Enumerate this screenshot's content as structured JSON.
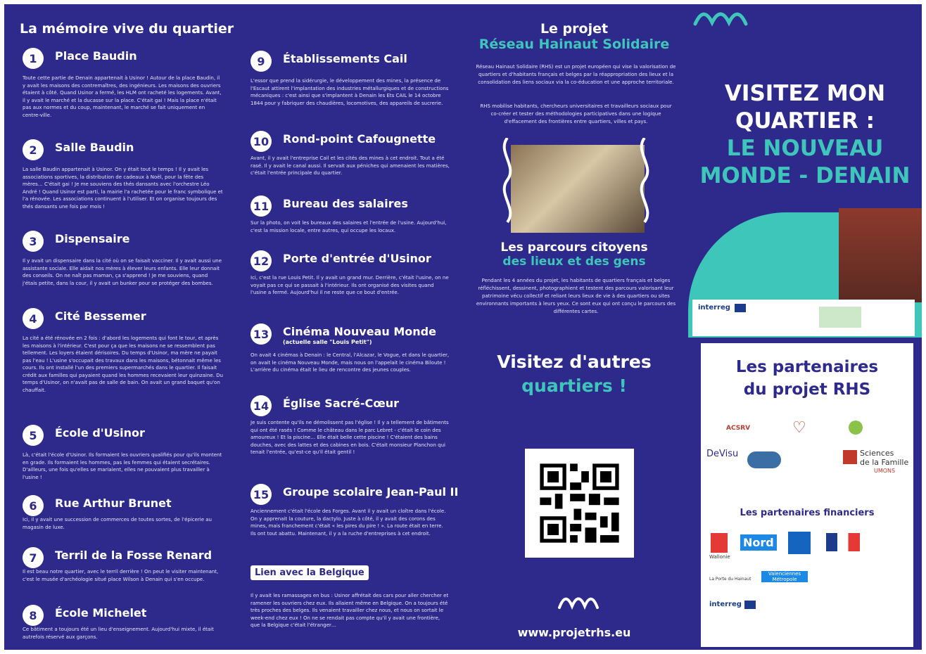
{
  "col1": {
    "heading": "La mémoire vive du quartier",
    "items": [
      {
        "num": "1",
        "name": "Place Baudin",
        "desc": "Toute cette partie de Denain appartenait à Usinor ! Autour de la place Baudin, il y avait les maisons des contremaîtres, des ingénieurs. Les maisons des ouvriers étaient à côté. Quand Usinor a fermé, les HLM ont racheté les logements. Avant, il y avait le marché et la ducasse sur la place. C'était gai ! Mais la place n'était pas aux normes et du coup, maintenant, le marché se fait uniquement en centre-ville."
      },
      {
        "num": "2",
        "name": "Salle Baudin",
        "desc": "La salle Baudin appartenait à Usinor. On y était tout le temps ! Il y avait les associations sportives, la distribution de cadeaux à Noël, pour la fête des mères… C'était gai ! Je me souviens des thés dansants avec l'orchestre Léo André ! Quand Usinor est parti, la mairie l'a rachetée pour le franc symbolique et l'a rénovée. Les associations continuent à l'utiliser. Et on organise toujours des thés dansants une fois par mois !"
      },
      {
        "num": "3",
        "name": "Dispensaire",
        "desc": "Il y avait un dispensaire dans la cité où on se faisait vacciner. Il y avait aussi une assistante sociale. Elle aidait nos mères à élever leurs enfants. Elle leur donnait des conseils. On ne naît pas maman, ça s'apprend ! Je me souviens, quand j'étais petite, dans la cour, il y avait un bunker pour se protéger des bombes."
      },
      {
        "num": "4",
        "name": "Cité Bessemer",
        "desc": "La cité a été rénovée en 2 fois : d'abord les logements qui font le tour, et après les maisons à l'intérieur. C'est pour ça que les maisons ne se ressemblent pas tellement. Les loyers étaient dérisoires. Du temps d'Usinor, ma mère ne payait pas l'eau ! L'usine s'occupait des travaux dans les maisons, bétonnait même les cours. Ils ont installé l'un des premiers supermarchés dans le quartier. Il faisait crédit aux familles qui payaient quand les hommes recevaient leur quinzaine. Du temps d'Usinor, on n'avait pas de salle de bain. On avait un grand baquet qu'on chauffait."
      },
      {
        "num": "5",
        "name": "École d'Usinor",
        "desc": "Là, c'était l'école d'Usinor. Ils formaient les ouvriers qualifiés pour qu'ils montent en grade. Ils formaient les hommes, pas les femmes qui étaient secrétaires. D'ailleurs, une fois qu'elles se mariaient, elles ne pouvaient plus travailler à l'usine !"
      },
      {
        "num": "6",
        "name": "Rue Arthur Brunet",
        "desc": "Ici, il y avait une succession de commerces de toutes sortes, de l'épicerie au magasin de luxe."
      },
      {
        "num": "7",
        "name": "Terril de la Fosse Renard",
        "desc": "Il est beau notre quartier, avec le terril derrière ! On peut le visiter maintenant, c'est le musée d'archéologie situé place Wilson à Denain qui s'en occupe."
      },
      {
        "num": "8",
        "name": "École Michelet",
        "desc": "Ce bâtiment a toujours été un lieu d'enseignement. Aujourd'hui mixte, il était autrefois réservé aux garçons."
      }
    ]
  },
  "col2": {
    "items": [
      {
        "num": "9",
        "name": "Établissements Cail",
        "sub": "",
        "desc": "L'essor que prend la sidérurgie, le développement des mines, la présence de l'Escaut attirent l'implantation des industries métallurgiques et de constructions mécaniques : c'est ainsi que s'implantent à Denain les Ets CAIL le 14 octobre 1844 pour y fabriquer des chaudières, locomotives, des appareils de sucrerie."
      },
      {
        "num": "10",
        "name": "Rond-point Cafougnette",
        "sub": "",
        "desc": "Avant, il y avait l'entreprise Cail et les cités des mines à cet endroit. Tout a été rasé. Il y avait le canal aussi. Il servait aux péniches qui amenaient les matières, c'était l'entrée principale du quartier."
      },
      {
        "num": "11",
        "name": "Bureau des salaires",
        "sub": "",
        "desc": "Sur la photo, on voit les bureaux des salaires et l'entrée de l'usine. Aujourd'hui, c'est la mission locale, entre autres, qui occupe les locaux."
      },
      {
        "num": "12",
        "name": "Porte d'entrée d'Usinor",
        "sub": "",
        "desc": "Ici, c'est la rue Louis Petit. Il y avait un grand mur. Derrière, c'était l'usine, on ne voyait pas ce qui se passait à l'intérieur. Ils ont organisé des visites quand l'usine a fermé. Aujourd'hui il ne reste que ce bout d'entrée."
      },
      {
        "num": "13",
        "name": "Cinéma Nouveau Monde",
        "sub": "(actuelle salle \"Louis Petit\")",
        "desc": "On avait 4 cinémas à Denain : le Central, l'Alcazar, le Vogue, et dans le quartier, on avait le cinéma Nouveau Monde, mais nous on l'appelait le cinéma Biloute ! L'arrière du cinéma était le lieu de rencontre des jeunes couples."
      },
      {
        "num": "14",
        "name": "Église Sacré-Cœur",
        "sub": "",
        "desc": "Je suis contente qu'ils ne démolissent pas l'église ! Il y a tellement de bâtiments qui ont été rasés ! Comme le château dans le parc Lebret - c'était le coin des amoureux ! Et la piscine… Elle était belle cette piscine ! C'étaient des bains douches, avec des lattes et des cabines en bois. C'était monsieur Planchon qui tenait l'entrée, qu'est-ce qu'il était gentil !"
      },
      {
        "num": "15",
        "name": "Groupe scolaire Jean-Paul II",
        "sub": "",
        "desc": "Anciennement c'était l'école des Forges. Avant il y avait un cloître dans l'école. On y apprenait la couture, la dactylo. Juste à côté, il y avait des corons des mines, mais franchement c'était « les pires du pire ! ». La route était en terre. Ils ont tout abattu. Maintenant, il y a la ruche d'entreprises à cet endroit."
      }
    ],
    "belgique": {
      "label": "Lien avec la Belgique",
      "desc": "Il y avait les ramassages en bus : Usinor affrétait des cars pour aller chercher et ramener les ouvriers chez eux. Ils allaient même en Belgique. On a toujours été très proches des belges. Ils venaient travailler chez nous, et nous on sortait le week-end chez eux ! On ne se rendait pas compte qu'il y avait une frontière, que la Belgique c'était l'étranger…"
    }
  },
  "col3": {
    "title1": "Le projet",
    "title2": "Réseau Hainaut Solidaire",
    "p1": "Réseau Hainaut Solidaire (RHS) est un projet européen qui vise la valorisation de quartiers et d'habitants français et belges par la réappropriation des lieux et la consolidation des liens sociaux via la co-éducation et une approche territoriale.",
    "p2": "RHS mobilise habitants, chercheurs universitaires et travailleurs sociaux pour co-créer et tester des méthodologies participatives dans une logique d'effacement des frontières entre quartiers, villes et pays.",
    "parcours1": "Les parcours citoyens",
    "parcours2": "des lieux et des gens",
    "p3": "Pendant les 4 années du projet, les habitants de quartiers français et belges réfléchissent, dessinent, photographient et testent des parcours valorisant leur patrimoine vécu collectif et reliant leurs lieux de vie à des quartiers ou sites environnants importants à leurs yeux. Ce sont eux qui ont conçu le parcours des différentes cartes.",
    "visit1": "Visitez d'autres",
    "visit2": "quartiers !",
    "url": "www.projetrhs.eu"
  },
  "col4": {
    "title_l1": "VISITEZ MON",
    "title_l2": "QUARTIER :",
    "title_l3": "LE NOUVEAU",
    "title_l4": "MONDE - DENAIN",
    "interreg": "interreg",
    "partners_title1": "Les partenaires",
    "partners_title2": "du projet RHS",
    "financial": "Les partenaires financiers",
    "logos": {
      "acsrv": "ACSRV",
      "devisu": "DeVisu",
      "sciences1": "Sciences",
      "sciences2": "de la Famille",
      "umons": "UMONS",
      "nord": "Nord",
      "wallonie": "Wallonie",
      "valenciennes": "Valenciennes Métropole",
      "porte": "La Porte du Hainaut",
      "interreg2": "interreg"
    }
  },
  "colors": {
    "bg": "#2e2a8c",
    "teal": "#3fc6ba",
    "white": "#ffffff"
  }
}
